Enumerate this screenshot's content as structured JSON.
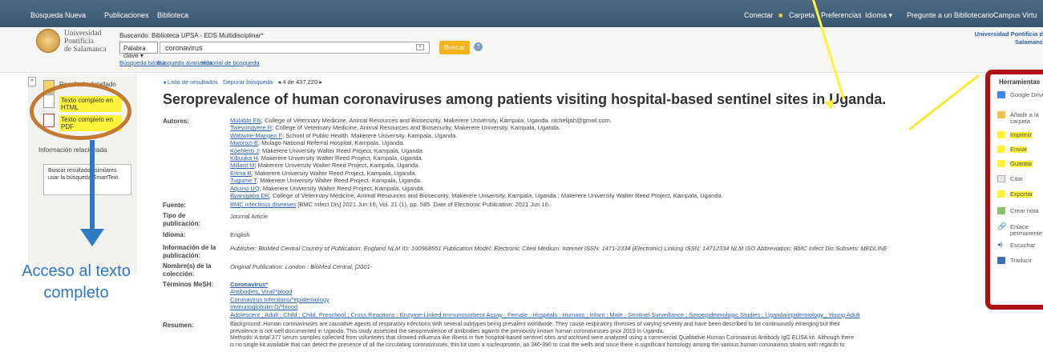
{
  "topbar": {
    "left": [
      "Búsqueda Nueva",
      "Publicaciones",
      "Biblioteca"
    ],
    "right": [
      "Conectar",
      "Carpeta",
      "Preferencias",
      "Idioma ▾",
      "Pregunte a un Bibliotecario",
      "Campus Virtu"
    ]
  },
  "header": {
    "logo": [
      "Universidad",
      "Pontificia",
      "de Salamanca"
    ],
    "searching": "Buscando: Biblioteca UPSA - EDS Multidisciplinar*",
    "field_select": "Palabra clave ▾",
    "query": "coronavirus",
    "clear": "×",
    "search_button": "Buscar",
    "help": "?",
    "links": [
      "Búsqueda básica",
      "Búsqueda avanzada",
      "Historial de búsqueda"
    ],
    "institution": [
      "Universidad Pontificia d",
      "Salamanc"
    ]
  },
  "left": {
    "collapse": "«",
    "heading": "Resultado detallado",
    "ft_html": "Texto completo en HTML",
    "ft_pdf": "Texto completo en PDF",
    "related": "Información relacionada",
    "smart": "Buscar resultados similares usar la búsqueda SmartText."
  },
  "annotation": {
    "line1": "Acceso al texto",
    "line2": "completo"
  },
  "nav": {
    "back": "◂ Lista de resultados",
    "refine": "Depurar búsqueda",
    "pos": "◂ 4 de 437,220 ▸"
  },
  "article": {
    "title": "Seroprevalence of human coronaviruses among patients visiting hospital-based sentinel sites in Uganda.",
    "labels": {
      "authors": "Autores:",
      "source": "Fuente:",
      "pubtype": "Tipo de publicación:",
      "lang": "Idioma:",
      "pubinfo": "Información de la publicación:",
      "coll": "Nombre(s) de la colección:",
      "mesh": "Términos MeSH:",
      "abstract": "Resumen:"
    },
    "authors": [
      {
        "name": "Mulabbi EN",
        "aff": "; College of Veterinary Medicine, Animal Resources and Biosecurity, Makerere University, Kampala, Uganda. nichelijah@gmail.com."
      },
      {
        "name": "Tweyongyere R",
        "aff": "; College of Veterinary Medicine, Animal Resources and Biosecurity, Makerere University, Kampala, Uganda."
      },
      {
        "name": "Wabwire-Mangen F",
        "aff": "; School of Public Health, Makerere University, Kampala, Uganda."
      },
      {
        "name": "Mworozi E",
        "aff": "; Mulago National Referral Hospital, Kampala, Uganda."
      },
      {
        "name": "Koehlerb J",
        "aff": "; Makerere University Walter Reed Project, Kampala, Uganda."
      },
      {
        "name": "Kibuuka H",
        "aff": "; Makerere University Walter Reed Project, Kampala, Uganda."
      },
      {
        "name": "Millard M",
        "aff": "; Makerere University Walter Reed Project, Kampala, Uganda."
      },
      {
        "name": "Erima B",
        "aff": "; Makerere University Walter Reed Project, Kampala, Uganda."
      },
      {
        "name": "Tugume T",
        "aff": "; Makerere University Walter Reed Project, Kampala, Uganda."
      },
      {
        "name": "Aquino UQ",
        "aff": "; Makerere University Walter Reed Project, Kampala, Uganda."
      },
      {
        "name": "Byarugaba DK",
        "aff": "; College of Veterinary Medicine, Animal Resources and Biosecurity, Makerere University, Kampala, Uganda.; Makerere University Walter Reed Project, Kampala, Uganda."
      }
    ],
    "source_link": "BMC infectious diseases",
    "source_rest": " [BMC Infect Dis] 2021 Jun 16; Vol. 21 (1), pp. 585. Date of Electronic Publication: 2021 Jun 16.",
    "pubtype": "Journal Article",
    "lang": "English",
    "pubinfo": "Publisher: BioMed Central Country of Publication: England NLM ID: 100968551 Publication Model: Electronic Cited Medium: Internet ISSN: 1471-2334 (Electronic) Linking ISSN: 14712334 NLM ISO Abbreviation: BMC Infect Dis Subsets: MEDLINE",
    "coll": "Original Publication: London : BioMed Central, [2001-",
    "mesh": [
      "Coronavirus*",
      "Antibodies, Viral/*blood",
      "Coronavirus Infections/*epidemiology",
      "Immunoglobulin G/*blood",
      "Adolescent ; Adult ; Child ; Child, Preschool ; Cross Reactions ; Enzyme-Linked Immunosorbent Assay ; Female ; Hospitals ; Humans ; Infant ; Male ; Sentinel Surveillance ; Seroepidemiologic Studies ; Uganda/epidemiology ; Young Adult"
    ],
    "abstract": [
      "Background: Human coronaviruses are causative agents of respiratory infections with several subtypes being prevalent worldwide. They cause respiratory illnesses of varying severity and have been described to be continuously emerging but their",
      "prevalence is not well documented in Uganda. This study assessed the seroprevalence of antibodies against the previously known human coronaviruses prior 2019 in Uganda.",
      "Methods: A total 377 serum samples collected from volunteers that showed influenza like illness in five hospital-based sentinel sites and archived were analyzed using a commercial Qualitative Human Coronavirus Antibody IgG ELISA kit. Although there",
      "is no single kit available that can detect the presence of all the circulating coronaviruses, this kit uses a nucleoprotein, aa 340-390 to coat the wells and since there is significant homology among the various human coronavirus strains with regards to"
    ]
  },
  "tools": {
    "heading": "Herramientas",
    "items": [
      "Google Drive",
      "Añadir a la carpeta",
      "Imprimir",
      "Enviar",
      "Guardar",
      "Citar",
      "Exportar",
      "Crear nota",
      "Enlace permanente",
      "Escuchar",
      "Traducir"
    ]
  },
  "colors": {
    "accent": "#2b62b0",
    "highlight": "#fff33a",
    "annotation_red": "#b00e14",
    "annotation_brown": "#c27a34",
    "annotation_blue": "#2e78c4"
  }
}
